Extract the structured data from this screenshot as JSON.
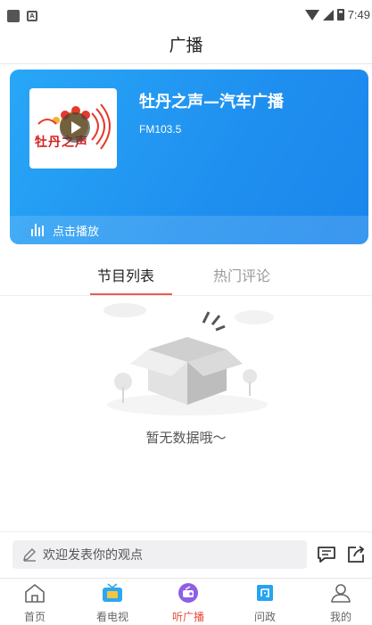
{
  "status_bar": {
    "time": "7:49"
  },
  "header": {
    "title": "广播"
  },
  "station": {
    "name": "牡丹之声—汽车广播",
    "frequency": "FM103.5",
    "logo_text": "牡丹之声",
    "play_label": "点击播放"
  },
  "tabs": [
    {
      "label": "节目列表",
      "active": true
    },
    {
      "label": "热门评论",
      "active": false
    }
  ],
  "empty_state": {
    "message": "暂无数据哦～"
  },
  "comment": {
    "placeholder": "欢迎发表你的观点"
  },
  "bottom_nav": [
    {
      "label": "首页",
      "icon": "home-icon",
      "active": false
    },
    {
      "label": "看电视",
      "icon": "tv-icon",
      "active": false
    },
    {
      "label": "听广播",
      "icon": "radio-icon",
      "active": true
    },
    {
      "label": "问政",
      "icon": "question-icon",
      "active": false
    },
    {
      "label": "我的",
      "icon": "person-icon",
      "active": false
    }
  ],
  "colors": {
    "accent": "#e84d3f",
    "card_blue": "#1f8fef",
    "tv_blue": "#2aa8f2",
    "radio_purple": "#8f5ee6"
  }
}
